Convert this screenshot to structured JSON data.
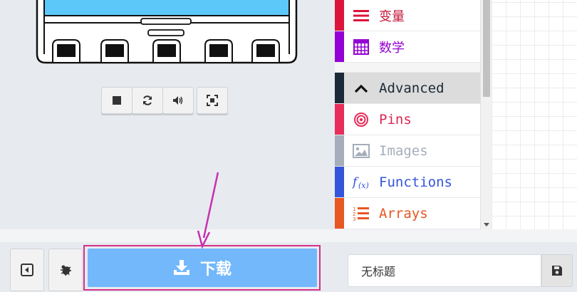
{
  "toolbox": {
    "items": [
      {
        "label": "变量",
        "icon": "variables-icon",
        "color": "#dc143c",
        "style": "zh"
      },
      {
        "label": "数学",
        "icon": "math-icon",
        "color": "#9400d3",
        "style": "zh"
      },
      {
        "label": "Advanced",
        "icon": "chevron-up-icon",
        "color": "#1b2a38",
        "style": "advanced"
      },
      {
        "label": "Pins",
        "icon": "pins-icon",
        "color": "#e82d5a",
        "style": "normal"
      },
      {
        "label": "Images",
        "icon": "image-icon",
        "color": "#a6adbb",
        "style": "normal"
      },
      {
        "label": "Functions",
        "icon": "function-icon",
        "color": "#3455db",
        "style": "normal"
      },
      {
        "label": "Arrays",
        "icon": "list-icon",
        "color": "#e65722",
        "style": "normal"
      }
    ]
  },
  "simulator": {
    "controls": [
      "stop-icon",
      "restart-icon",
      "sound-icon",
      "fullscreen-icon"
    ]
  },
  "footer": {
    "download_label": "下载",
    "project_name": "无标题"
  },
  "colors": {
    "download": "#73b8fb",
    "highlight": "#d6308a"
  }
}
